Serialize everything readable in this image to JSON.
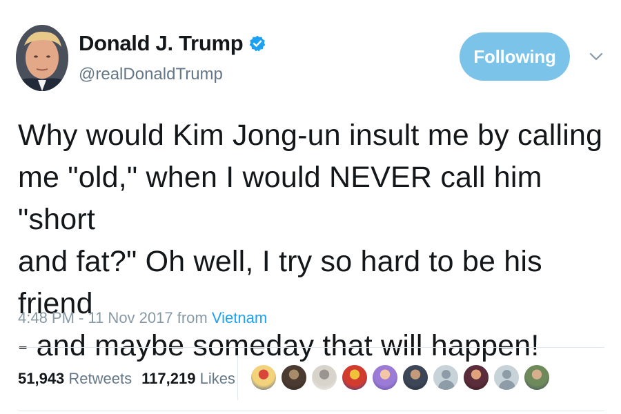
{
  "author": {
    "name": "Donald J. Trump",
    "handle": "@realDonaldTrump",
    "verified": true
  },
  "follow_button": {
    "label": "Following"
  },
  "tweet": {
    "lines": [
      "Why would Kim Jong-un insult me by calling",
      "me \"old,\" when I would NEVER call him \"short",
      "and fat?\" Oh well, I try so hard to be his friend",
      "- and maybe someday that will happen!"
    ]
  },
  "meta": {
    "time_date": "4:48 PM - 11 Nov 2017 from",
    "location": "Vietnam"
  },
  "stats": {
    "retweets_count": "51,943",
    "retweets_label": "Retweets",
    "likes_count": "117,219",
    "likes_label": "Likes"
  },
  "likers": [
    {
      "kind": "photo",
      "colors": [
        "#f2d27a",
        "#d9453b",
        "#2b4c8c"
      ]
    },
    {
      "kind": "photo",
      "colors": [
        "#4a3a30",
        "#a88b6a",
        "#2a2522"
      ]
    },
    {
      "kind": "photo",
      "colors": [
        "#d8d4cc",
        "#9a9590",
        "#f3f1ec"
      ]
    },
    {
      "kind": "photo",
      "colors": [
        "#d23c2f",
        "#f0c23b",
        "#2d3f8f"
      ]
    },
    {
      "kind": "photo",
      "colors": [
        "#9b7bd6",
        "#f3c7a5",
        "#5a4aa0"
      ]
    },
    {
      "kind": "photo",
      "colors": [
        "#3d4656",
        "#c49a7a",
        "#1f2530"
      ]
    },
    {
      "kind": "egg",
      "colors": [
        "#c8d2d9",
        "#8e9ca7",
        "#c8d2d9"
      ]
    },
    {
      "kind": "photo",
      "colors": [
        "#5b2d3a",
        "#e0a27c",
        "#2a1418"
      ]
    },
    {
      "kind": "egg",
      "colors": [
        "#c8d2d9",
        "#8e9ca7",
        "#c8d2d9"
      ]
    },
    {
      "kind": "photo",
      "colors": [
        "#6f8a5a",
        "#d6b08e",
        "#3a4a60"
      ]
    }
  ],
  "colors": {
    "accent": "#1da1f2",
    "follow_button_bg": "#7cc3ea",
    "text": "#14171a",
    "muted": "#657786"
  }
}
